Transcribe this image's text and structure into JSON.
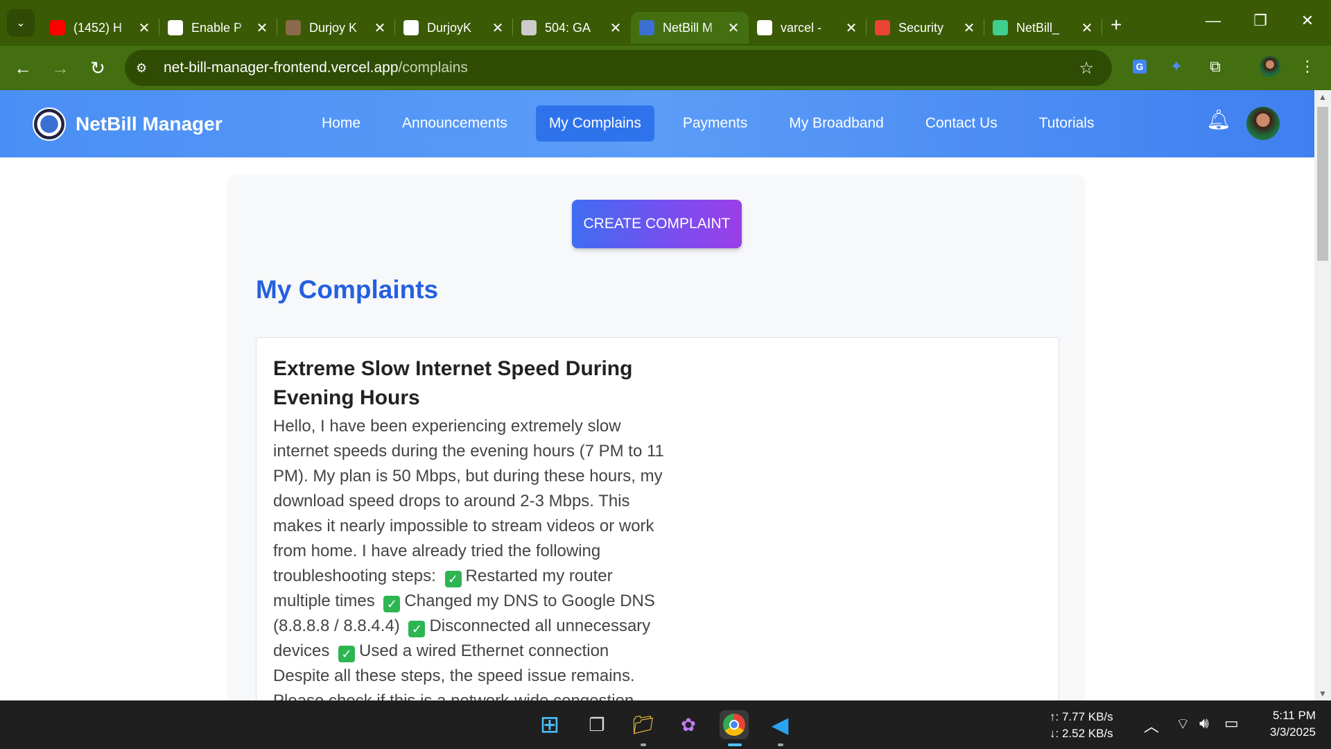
{
  "browser": {
    "tabs": [
      {
        "title": "(1452) H",
        "favicon": "youtube-icon",
        "color": "#ff0000"
      },
      {
        "title": "Enable P",
        "favicon": "openai-icon",
        "color": "#ffffff"
      },
      {
        "title": "Durjoy K",
        "favicon": "profile-photo-icon",
        "color": "#8a6a4a"
      },
      {
        "title": "DurjoyK",
        "favicon": "github-icon",
        "color": "#ffffff"
      },
      {
        "title": "504: GA",
        "favicon": "globe-icon",
        "color": "#cccccc"
      },
      {
        "title": "NetBill M",
        "favicon": "netbill-icon",
        "color": "#3b6fd4"
      },
      {
        "title": "varcel -",
        "favicon": "google-icon",
        "color": "#ffffff"
      },
      {
        "title": "Security",
        "favicon": "gmail-icon",
        "color": "#ea4335"
      },
      {
        "title": "NetBill_",
        "favicon": "bolt-icon",
        "color": "#3ecf8e"
      }
    ],
    "active_tab_index": 5,
    "close_glyph": "✕",
    "new_tab_glyph": "+",
    "url_host": "net-bill-manager-frontend.vercel.app",
    "url_path": "/complains"
  },
  "navbar": {
    "brand": "NetBill Manager",
    "links": [
      "Home",
      "Announcements",
      "My Complains",
      "Payments",
      "My Broadband",
      "Contact Us",
      "Tutorials"
    ],
    "active_link": "My Complains"
  },
  "main": {
    "create_button": "CREATE COMPLAINT",
    "heading": "My Complaints",
    "complaint": {
      "title": "Extreme Slow Internet Speed During Evening Hours",
      "body_intro": "Hello, I have been experiencing extremely slow internet speeds during the evening hours (7 PM to 11 PM). My plan is 50 Mbps, but during these hours, my download speed drops to around 2-3 Mbps. This makes it nearly impossible to stream videos or work from home. I have already tried the following troubleshooting steps:",
      "steps": [
        "Restarted my router multiple times",
        "Changed my DNS to Google DNS (8.8.8.8 / 8.8.4.4)",
        "Disconnected all unnecessary devices",
        "Used a wired Ethernet connection"
      ],
      "body_outro": "Despite all these steps, the speed issue remains. Please check if this is a network-wide congestion problem or something specific to my connection."
    }
  },
  "taskbar": {
    "upload_speed": "↑: 7.77 KB/s",
    "download_speed": "↓: 2.52 KB/s",
    "time": "5:11 PM",
    "date": "3/3/2025"
  }
}
